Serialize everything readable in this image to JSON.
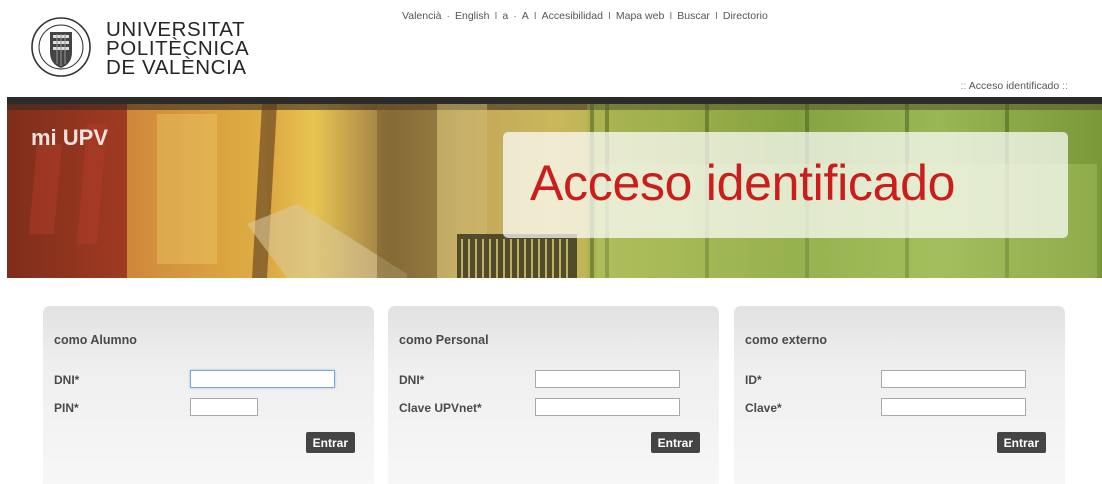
{
  "logo": {
    "line1": "UNIVERSITAT",
    "line2": "POLITÈCNICA",
    "line3": "DE VALÈNCIA"
  },
  "topnav": {
    "items": [
      "Valencià",
      "English",
      "a",
      "A",
      "Accesibilidad",
      "Mapa web",
      "Buscar",
      "Directorio"
    ]
  },
  "access_link": "Acceso identificado",
  "banner": {
    "label": "mi UPV",
    "title": "Acceso identificado"
  },
  "panels": [
    {
      "title": "como Alumno",
      "fields": [
        {
          "label": "DNI*",
          "value": ""
        },
        {
          "label": "PIN*",
          "value": ""
        }
      ],
      "button": "Entrar"
    },
    {
      "title": "como Personal",
      "fields": [
        {
          "label": "DNI*",
          "value": ""
        },
        {
          "label": "Clave UPVnet*",
          "value": ""
        }
      ],
      "button": "Entrar"
    },
    {
      "title": "como externo",
      "fields": [
        {
          "label": "ID*",
          "value": ""
        },
        {
          "label": "Clave*",
          "value": ""
        }
      ],
      "button": "Entrar"
    }
  ],
  "colors": {
    "title_red": "#cc1d1d",
    "button_bg": "#444444",
    "panel_bg": "#efefef",
    "topbar": "#2b2b2b"
  }
}
